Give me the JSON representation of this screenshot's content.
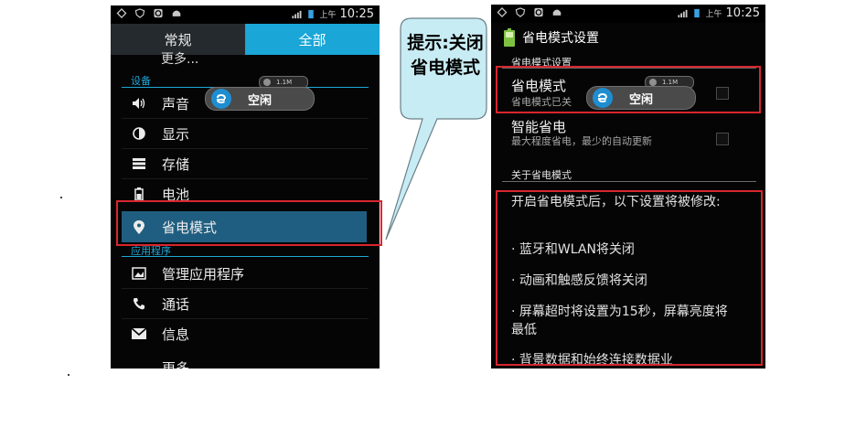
{
  "left_phone": {
    "status_time": "10:25",
    "status_ampm": "上午",
    "tabs": [
      {
        "label": "常规",
        "active": false
      },
      {
        "label": "全部",
        "active": true
      }
    ],
    "more_top": "更多...",
    "section_device": "设备",
    "items": [
      {
        "label": "声音",
        "icon": "volume-icon"
      },
      {
        "label": "显示",
        "icon": "brightness-icon"
      },
      {
        "label": "存储",
        "icon": "storage-icon"
      },
      {
        "label": "电池",
        "icon": "battery-icon"
      },
      {
        "label": "省电模式",
        "icon": "power-saving-icon",
        "selected": true
      }
    ],
    "section_apps": "应用程序",
    "app_items": [
      {
        "label": "管理应用程序",
        "icon": "apps-icon"
      },
      {
        "label": "通话",
        "icon": "phone-icon"
      },
      {
        "label": "信息",
        "icon": "message-icon"
      },
      {
        "label": "更多",
        "icon": "more-icon"
      }
    ],
    "idle_popup": {
      "label": "空闲",
      "speed": "1.1M"
    }
  },
  "right_phone": {
    "status_time": "10:25",
    "status_ampm": "上午",
    "title": "省电模式设置",
    "section_settings": "省电模式设置",
    "power_saving": {
      "title": "省电模式",
      "subtitle": "省电模式已关"
    },
    "smart_saving": {
      "title": "智能省电",
      "subtitle": "最大程度省电，最少的自动更新"
    },
    "section_about": "关于省电模式",
    "info_lines": [
      "开启省电模式后，以下设置将被修改:",
      "· 蓝牙和WLAN将关闭",
      "· 动画和触感反馈将关闭",
      "· 屏幕超时将设置为15秒，屏幕亮度将最低",
      "· 背景数据和始终连接数据业"
    ],
    "idle_popup": {
      "label": "空闲",
      "speed": "1.1M"
    }
  },
  "callout": {
    "text": "提示:关闭省电模式"
  },
  "colors": {
    "accent": "#1ea8d9",
    "highlight_box": "#d8262e",
    "selected_row": "#1f5e80",
    "callout_fill": "#c8ecf4"
  }
}
